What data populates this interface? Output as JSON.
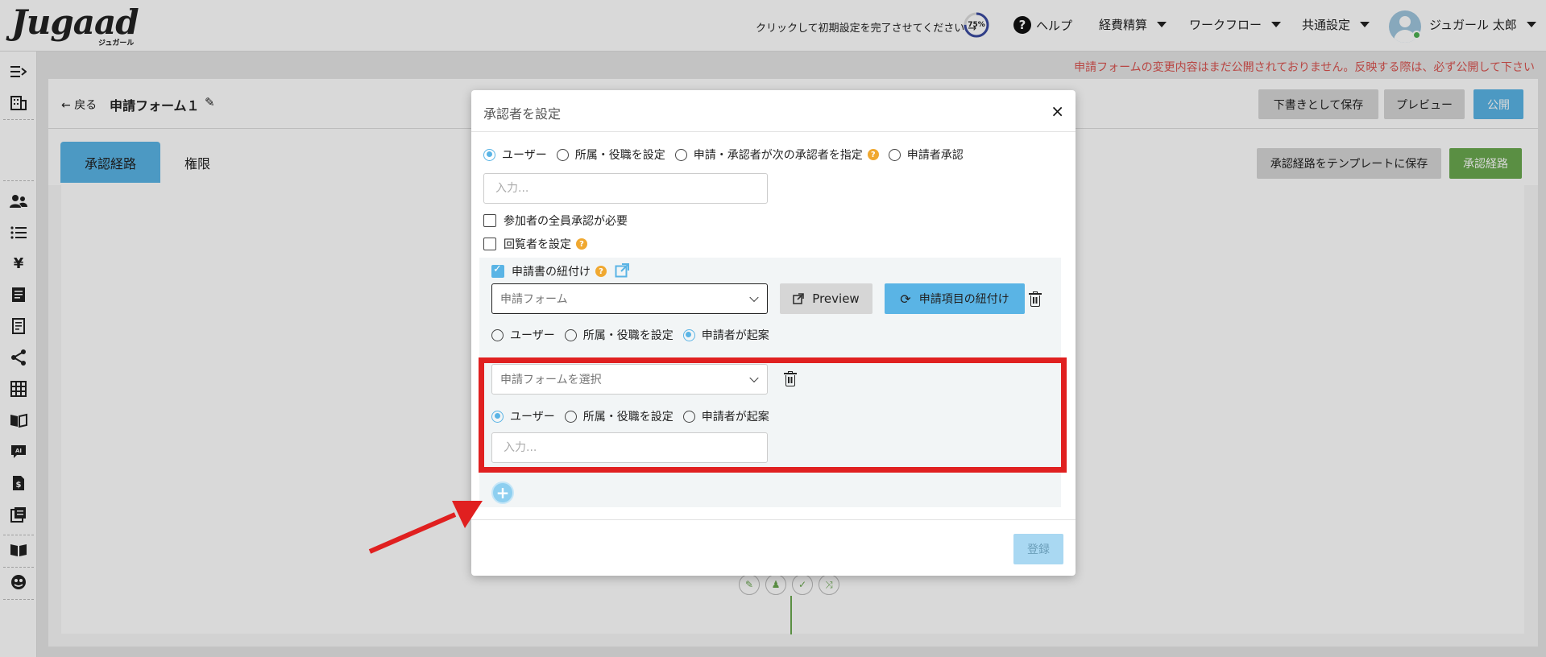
{
  "header": {
    "logo_text": "Jugaad",
    "logo_sub": "ジュガール",
    "setup_message": "クリックして初期設定を完了させてください →",
    "progress_label": "75%",
    "progress_value": 75,
    "help_label": "ヘルプ",
    "nav": [
      "経費精算",
      "ワークフロー",
      "共通設定"
    ],
    "user_name": "ジュガール 太郎"
  },
  "notice": "申請フォームの変更内容はまだ公開されておりません。反映する際は、必ず公開して下さい",
  "topbar": {
    "back_label": "戻る",
    "form_title": "申請フォーム１",
    "save_draft": "下書きとして保存",
    "preview": "プレビュー",
    "publish": "公開"
  },
  "tabs": [
    {
      "label": "承認経路",
      "active": true
    },
    {
      "label": "権限",
      "active": false
    }
  ],
  "route_actions": {
    "save_template": "承認経路をテンプレートに保存",
    "route": "承認経路"
  },
  "modal": {
    "title": "承認者を設定",
    "close": "×",
    "approver_types": [
      {
        "label": "ユーザー",
        "checked": true
      },
      {
        "label": "所属・役職を設定",
        "checked": false
      },
      {
        "label": "申請・承認者が次の承認者を指定",
        "checked": false
      },
      {
        "label": "申請者承認",
        "checked": false
      }
    ],
    "user_input_placeholder": "入力...",
    "require_all_label": "参加者の全員承認が必要",
    "circulate_label": "回覧者を設定",
    "link_form_label": "申請書の紐付け",
    "linked_form": {
      "select_value": "申請フォーム",
      "preview_label": "Preview",
      "link_items_label": "申請項目の紐付け",
      "options": [
        {
          "label": "ユーザー",
          "checked": false
        },
        {
          "label": "所属・役職を設定",
          "checked": false
        },
        {
          "label": "申請者が起案",
          "checked": true
        }
      ]
    },
    "new_form": {
      "select_placeholder": "申請フォームを選択",
      "options": [
        {
          "label": "ユーザー",
          "checked": true
        },
        {
          "label": "所属・役職を設定",
          "checked": false
        },
        {
          "label": "申請者が起案",
          "checked": false
        }
      ],
      "input_placeholder": "入力..."
    },
    "add_label": "+",
    "register_label": "登録"
  },
  "colors": {
    "accent": "#5ab4e5",
    "green": "#6aa84f",
    "danger": "#e02020",
    "warning": "#f0a830"
  }
}
